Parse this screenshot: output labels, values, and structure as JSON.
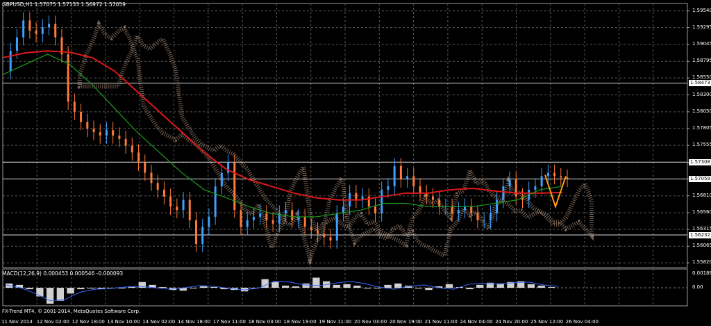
{
  "chart_data": {
    "type": "candlestick",
    "symbol_header": "GBPUSD,H1  1.57075 1.57133 1.56972 1.57059",
    "price_axis": {
      "ylim": [
        1.5575,
        1.5965
      ],
      "tick_labels": [
        "1.59540",
        "1.59295",
        "1.59045",
        "1.58795",
        "1.58550",
        "1.58300",
        "1.58050",
        "1.57805",
        "1.57555",
        "1.57305",
        "1.57060",
        "1.56810",
        "1.56560",
        "1.56315",
        "1.56065",
        "1.55820"
      ],
      "tick_values": [
        1.5954,
        1.59295,
        1.59045,
        1.58795,
        1.5855,
        1.583,
        1.5805,
        1.57805,
        1.57555,
        1.57305,
        1.5706,
        1.5681,
        1.5656,
        1.56315,
        1.56065,
        1.5582
      ]
    },
    "horizontal_levels": [
      {
        "label": "1.58473",
        "value": 1.58473
      },
      {
        "label": "1.57308",
        "value": 1.57308
      },
      {
        "label": "1.57059",
        "value": 1.57059
      },
      {
        "label": "1.56232",
        "value": 1.56232
      }
    ],
    "date_labels": [
      "11 Nov 2014",
      "12 Nov 02:00",
      "12 Nov 18:00",
      "13 Nov 10:00",
      "14 Nov 02:00",
      "14 Nov 18:00",
      "17 Nov 11:00",
      "18 Nov 03:00",
      "18 Nov 19:00",
      "19 Nov 11:00",
      "20 Nov 03:00",
      "20 Nov 19:00",
      "21 Nov 11:00",
      "24 Nov 04:00",
      "24 Nov 20:00",
      "25 Nov 12:00",
      "26 Nov 04:00"
    ],
    "close_path": [
      1.5865,
      1.5895,
      1.5915,
      1.594,
      1.5925,
      1.592,
      1.593,
      1.5935,
      1.5915,
      1.589,
      1.582,
      1.5805,
      1.579,
      1.578,
      1.5775,
      1.577,
      1.5778,
      1.577,
      1.5765,
      1.5755,
      1.5745,
      1.573,
      1.5715,
      1.57,
      1.569,
      1.568,
      1.5665,
      1.566,
      1.5675,
      1.5645,
      1.561,
      1.5635,
      1.565,
      1.5695,
      1.5715,
      1.573,
      1.566,
      1.5635,
      1.5645,
      1.565,
      1.5655,
      1.5645,
      1.564,
      1.5655,
      1.566,
      1.5645,
      1.565,
      1.5635,
      1.563,
      1.5625,
      1.562,
      1.5615,
      1.5655,
      1.5665,
      1.5685,
      1.5675,
      1.568,
      1.5665,
      1.5655,
      1.569,
      1.5695,
      1.5725,
      1.5705,
      1.571,
      1.5695,
      1.5685,
      1.568,
      1.5675,
      1.5665,
      1.5665,
      1.5655,
      1.566,
      1.5665,
      1.5655,
      1.5645,
      1.5645,
      1.5655,
      1.5675,
      1.5695,
      1.5705,
      1.568,
      1.5675,
      1.569,
      1.5695,
      1.571,
      1.5715,
      1.571,
      1.5708,
      1.5706
    ],
    "moving_averages": [
      {
        "color": "#e01818",
        "values": [
          1.5885,
          1.5892,
          1.5895,
          1.5893,
          1.5885,
          1.5865,
          1.5835,
          1.5805,
          1.5775,
          1.5745,
          1.572,
          1.5705,
          1.5695,
          1.5685,
          1.5678,
          1.5675,
          1.5675,
          1.568,
          1.5685,
          1.5685,
          1.569,
          1.5692,
          1.5688,
          1.5685,
          1.5685,
          1.5686
        ]
      },
      {
        "color": "#18a018",
        "values": [
          1.586,
          1.5875,
          1.589,
          1.5875,
          1.5845,
          1.581,
          1.5775,
          1.5745,
          1.5715,
          1.569,
          1.5678,
          1.5665,
          1.5655,
          1.565,
          1.565,
          1.5655,
          1.566,
          1.567,
          1.567,
          1.5665,
          1.5665,
          1.5665,
          1.567,
          1.5675,
          1.569,
          1.5695
        ]
      }
    ],
    "projection": {
      "color": "#ff9a1a",
      "values": [
        1.5712,
        1.5665,
        1.571
      ]
    },
    "macd": {
      "header": "MACD(12,26,9) 0.000453 0.000546 -0.000093",
      "tick_labels": [
        "0.001883",
        "0.00"
      ],
      "tick_values": [
        0.001883,
        0.0
      ],
      "ylim": [
        -0.0025,
        0.0026
      ],
      "histogram": [
        0.0006,
        0.0004,
        -0.0002,
        -0.0012,
        -0.0022,
        -0.0018,
        -0.0008,
        -0.0002,
        -0.0001,
        -0.0002,
        -0.0001,
        0.0,
        0.0002,
        0.0008,
        0.0004,
        0.0001,
        -0.0003,
        -0.0004,
        0.0,
        0.0002,
        0.0001,
        -0.0002,
        -0.0003,
        -0.0005,
        -0.0001,
        0.0012,
        0.0008,
        0.0003,
        0.0002,
        0.0006,
        0.0014,
        0.0009,
        0.0004,
        0.0005,
        0.0003,
        -0.0001,
        0.0,
        0.0004,
        0.0006,
        0.0003,
        -0.0001,
        -0.0003,
        0.0002,
        0.0005,
        0.0001,
        -0.0002,
        0.0004,
        0.0007,
        0.0006,
        0.0008,
        0.0009,
        0.0005,
        0.0003,
        0.0001
      ],
      "signal_line": [
        0.0004,
        0.0,
        -0.0008,
        -0.0018,
        -0.0016,
        -0.0006,
        -0.0002,
        -0.0001,
        0.0001,
        0.0002,
        0.0,
        -0.0002,
        0.0,
        0.0003,
        0.0002,
        -0.0001,
        -0.0003,
        0.0,
        0.0009,
        0.0008,
        0.0004,
        0.0003,
        0.0006,
        0.0009,
        0.0006,
        0.0001,
        -0.0002,
        0.0002,
        0.0004,
        0.0,
        -0.0002,
        0.0005,
        0.0006,
        0.0005,
        0.0007,
        0.0008,
        0.0004,
        0.0002
      ]
    }
  },
  "copyright": "FX-Trend MT4, © 2001-2014, MetaQuotes Software Corp."
}
